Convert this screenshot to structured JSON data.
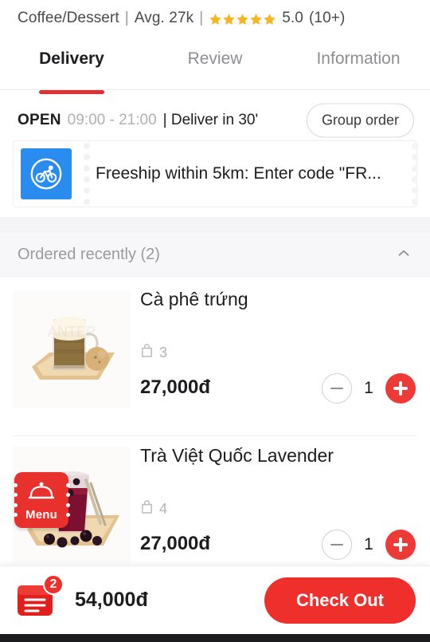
{
  "header": {
    "category": "Coffee/Dessert",
    "separator": "|",
    "avg_price": "Avg. 27k",
    "star_count": 5,
    "rating": "5.0",
    "review_count": "(10+)",
    "star_color": "#f5b622"
  },
  "tabs": [
    {
      "label": "Delivery",
      "active": true
    },
    {
      "label": "Review",
      "active": false
    },
    {
      "label": "Information",
      "active": false
    }
  ],
  "store_status": {
    "open_label": "OPEN",
    "hours": "09:00 - 21:00",
    "deliver_in": "| Deliver in 30'",
    "group_order_label": "Group order"
  },
  "promo": {
    "icon": "bicycle-delivery-icon",
    "text": "Freeship within 5km: Enter code \"FR...",
    "icon_bg": "#2b8cf0"
  },
  "section": {
    "title": "Ordered recently (2)",
    "collapse_icon": "chevron-up-icon"
  },
  "items": [
    {
      "name": "Cà phê trứng",
      "sold_icon": "shopping-bag-icon",
      "sold_count": "3",
      "price": "27,000đ",
      "quantity": "1",
      "minus_label": "−",
      "plus_label": "+",
      "image": "egg-coffee-on-wooden-board"
    },
    {
      "name": "Trà Việt Quốc Lavender",
      "sold_icon": "shopping-bag-icon",
      "sold_count": "4",
      "price": "27,000đ",
      "quantity": "1",
      "minus_label": "−",
      "plus_label": "+",
      "image": "berry-tea-on-wooden-board"
    }
  ],
  "menu_fab": {
    "label": "Menu",
    "icon": "cloche-serving-dome-icon",
    "bg": "#e8302c"
  },
  "bottom_bar": {
    "cart_icon": "cart-box-icon",
    "cart_badge": "2",
    "total": "54,000đ",
    "checkout_label": "Check Out",
    "accent": "#ee2f2b"
  }
}
